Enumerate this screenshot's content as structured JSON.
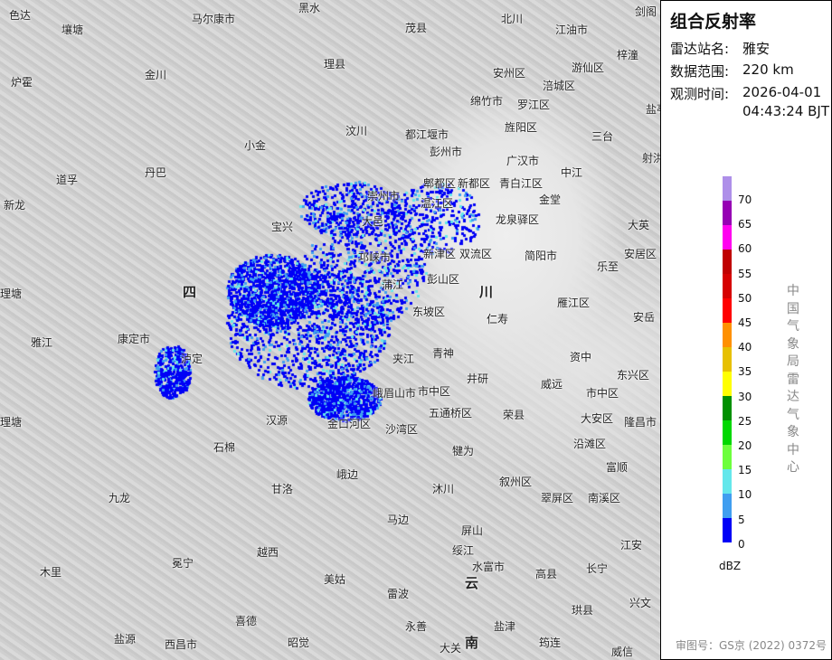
{
  "panel": {
    "title": "组合反射率",
    "station_label": "雷达站名:",
    "station": "雅安",
    "range_label": "数据范围:",
    "range": "220 km",
    "time_label": "观测时间:",
    "date": "2026-04-01",
    "time": "04:43:24 BJT",
    "agency": "中国气象局雷达气象中心",
    "unit": "dBZ",
    "approval": "审图号：GS京 (2022) 0372号"
  },
  "legend": {
    "colors": [
      "#ae8fe9",
      "#9600b4",
      "#ff00f0",
      "#c00000",
      "#d60000",
      "#ff0000",
      "#ff9000",
      "#e7c000",
      "#ffff00",
      "#009000",
      "#00d800",
      "#6dff3d",
      "#64e7eb",
      "#409ef0",
      "#0000f6"
    ],
    "ticks": [
      "70",
      "65",
      "60",
      "55",
      "50",
      "45",
      "40",
      "35",
      "30",
      "25",
      "20",
      "15",
      "10",
      "5",
      "0"
    ]
  },
  "map": {
    "labels": [
      "色达",
      "壤塘",
      "马尔康市",
      "黑水",
      "茂县",
      "北川",
      "江油市",
      "剑阁",
      "金川",
      "理县",
      "安州区",
      "游仙区",
      "梓潼",
      "炉霍",
      "绵竹市",
      "罗江区",
      "涪城区",
      "盐亭",
      "汶川",
      "旌阳区",
      "三台",
      "小金",
      "都江堰市",
      "彭州市",
      "广汉市",
      "中江",
      "射洪市",
      "道孚",
      "丹巴",
      "郫都区",
      "新都区",
      "青白江区",
      "崇州市",
      "温江区",
      "金堂",
      "新龙",
      "大邑",
      "龙泉驿区",
      "大英",
      "宝兴",
      "简阳市",
      "乐至",
      "安居区",
      "邛崃市",
      "新津区",
      "双流区",
      "蒲江",
      "彭山区",
      "雁江区",
      "理塘",
      "东坡区",
      "仁寿",
      "安岳",
      "雅江",
      "康定市",
      "泸定",
      "夹江",
      "青神",
      "资中",
      "东兴区",
      "井研",
      "威远",
      "市中区",
      "市中区",
      "五通桥区",
      "荣县",
      "大安区",
      "隆昌市",
      "汉源",
      "金口河区",
      "沙湾区",
      "峨眉山市",
      "石棉",
      "沿滩区",
      "犍为",
      "峨边",
      "富顺",
      "叙州区",
      "甘洛",
      "沐川",
      "九龙",
      "翠屏区",
      "南溪区",
      "马边",
      "屏山",
      "绥江",
      "江安",
      "越西",
      "冕宁",
      "水富市",
      "高县",
      "长宁",
      "木里",
      "美姑",
      "雷波",
      "珙县",
      "兴文",
      "喜德",
      "永善",
      "盐津",
      "盐源",
      "西昌市",
      "昭觉",
      "大关",
      "筠连",
      "威信",
      "理塘"
    ],
    "province_labels": [
      "四",
      "川",
      "云",
      "南"
    ]
  }
}
